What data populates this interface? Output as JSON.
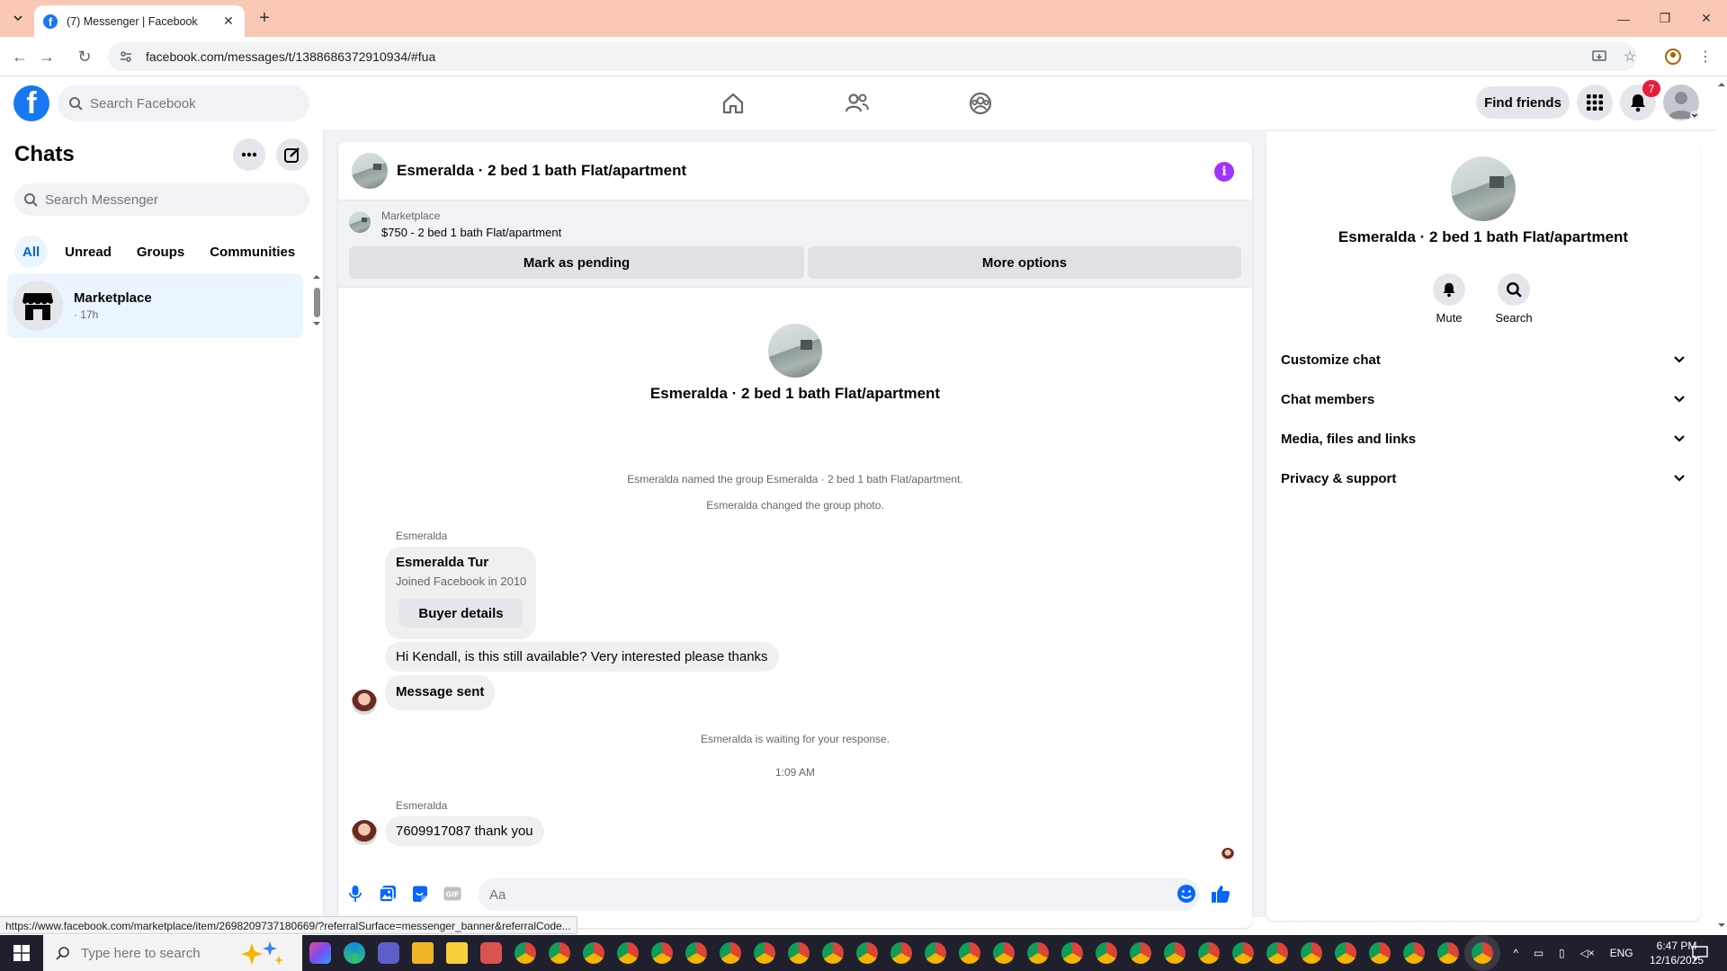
{
  "browser": {
    "tab_title": "(7) Messenger | Facebook",
    "url": "facebook.com/messages/t/1388686372910934/#fua",
    "status_url": "https://www.facebook.com/marketplace/item/2698209737180669/?referralSurface=messenger_banner&referralCode..."
  },
  "fb_header": {
    "search_placeholder": "Search Facebook",
    "find_friends": "Find friends",
    "notification_count": "7",
    "brand_color": "#1877f2"
  },
  "left": {
    "title": "Chats",
    "search_placeholder": "Search Messenger",
    "filters": [
      "All",
      "Unread",
      "Groups",
      "Communities"
    ],
    "chats": [
      {
        "name": "Marketplace",
        "time": "· 17h"
      }
    ]
  },
  "chat": {
    "title": "Esmeralda · 2 bed 1 bath Flat/apartment",
    "marketplace": {
      "label": "Marketplace",
      "listing": "$750 - 2 bed 1 bath Flat/apartment",
      "btn_pending": "Mark as pending",
      "btn_more": "More options"
    },
    "intro_title": "Esmeralda · 2 bed 1 bath Flat/apartment",
    "system": [
      "Esmeralda named the group Esmeralda · 2 bed 1 bath Flat/apartment.",
      "Esmeralda changed the group photo."
    ],
    "sender_name": "Esmeralda",
    "card": {
      "name": "Esmeralda Tur",
      "joined": "Joined Facebook in 2010",
      "button": "Buyer details"
    },
    "msg1": "Hi Kendall, is this still available? Very interested please thanks",
    "msg2": "Message sent",
    "waiting": "Esmeralda is waiting for your response.",
    "timestamp": "1:09 AM",
    "sender_name2": "Esmeralda",
    "msg3": "7609917087  thank you",
    "composer_placeholder": "Aa"
  },
  "right": {
    "title": "Esmeralda · 2 bed 1 bath Flat/apartment",
    "mute": "Mute",
    "search": "Search",
    "sections": [
      "Customize chat",
      "Chat members",
      "Media, files and links",
      "Privacy & support"
    ]
  },
  "taskbar": {
    "search_placeholder": "Type here to search",
    "lang": "ENG",
    "time": "6:47 PM",
    "date": "12/16/2025"
  }
}
